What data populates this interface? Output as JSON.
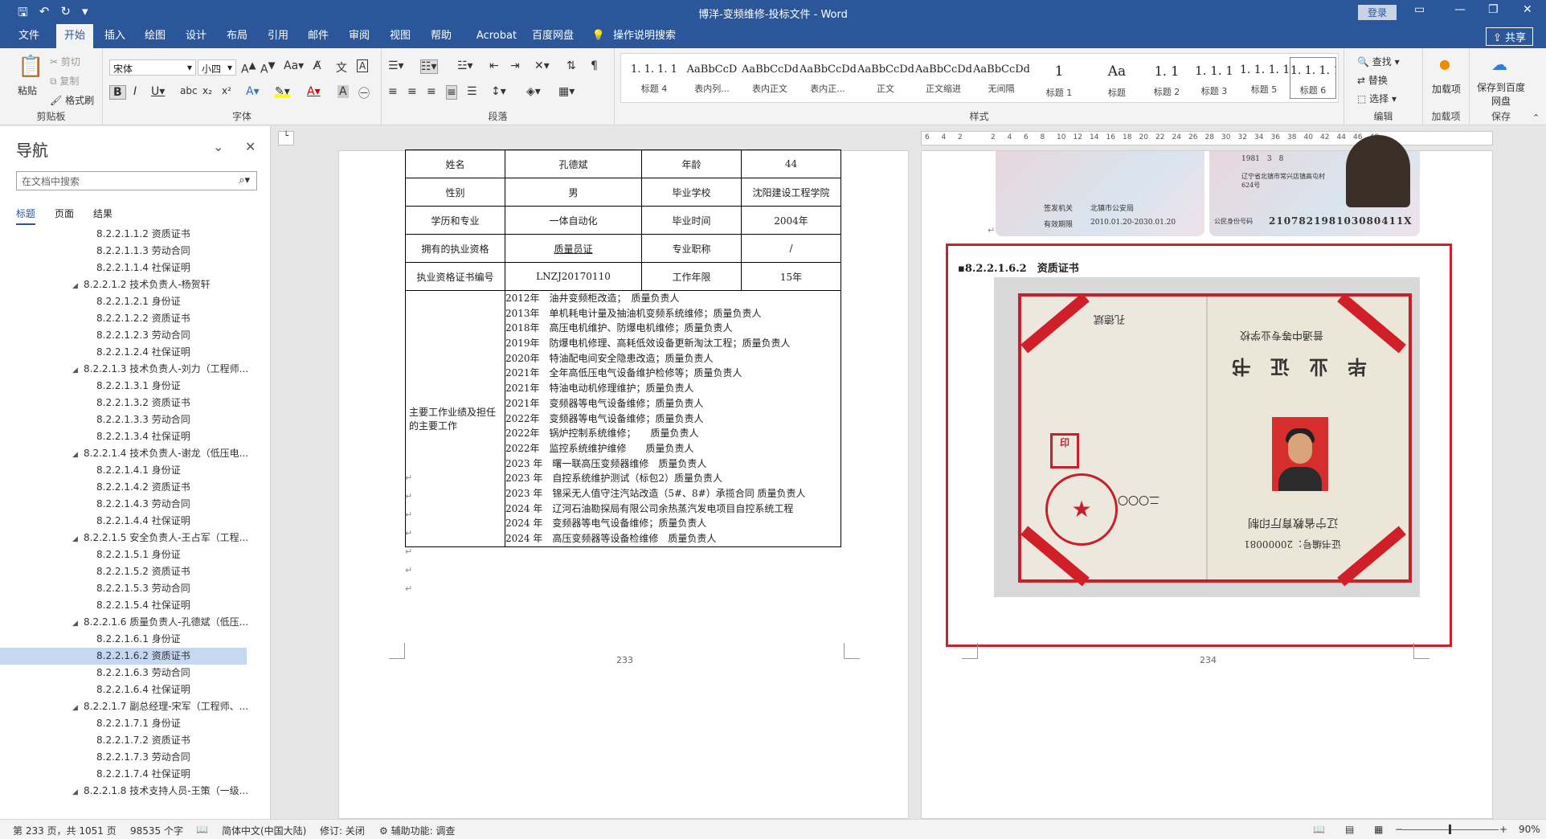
{
  "window": {
    "title": "博洋-变频维修-投标文件 - Word",
    "login": "登录"
  },
  "ribbon_tabs": [
    "文件",
    "开始",
    "插入",
    "绘图",
    "设计",
    "布局",
    "引用",
    "邮件",
    "审阅",
    "视图",
    "帮助",
    "Acrobat",
    "百度网盘",
    "操作说明搜索"
  ],
  "active_tab": "开始",
  "share_label": "共享",
  "clipboard": {
    "paste": "粘贴",
    "cut": "剪切",
    "copy": "复制",
    "format_painter": "格式刷",
    "label": "剪贴板"
  },
  "font": {
    "name": "宋体",
    "size": "小四",
    "label": "字体"
  },
  "paragraph": {
    "label": "段落"
  },
  "styles": {
    "label": "样式",
    "items": [
      {
        "sample": "1. 1. 1. 1",
        "name": "标题 4"
      },
      {
        "sample": "AaBbCcD",
        "name": "表内列..."
      },
      {
        "sample": "AaBbCcDdI",
        "name": "表内正文"
      },
      {
        "sample": "AaBbCcDdI",
        "name": "表内正..."
      },
      {
        "sample": "AaBbCcDdI",
        "name": "正文"
      },
      {
        "sample": "AaBbCcDdI",
        "name": "正文缩进"
      },
      {
        "sample": "AaBbCcDdI",
        "name": "无间隔"
      },
      {
        "sample": "1",
        "name": "标题 1"
      },
      {
        "sample": "Aa",
        "name": "标题"
      },
      {
        "sample": "1. 1",
        "name": "标题 2"
      },
      {
        "sample": "1. 1. 1",
        "name": "标题 3"
      },
      {
        "sample": "1. 1. 1. 1.",
        "name": "标题 5"
      },
      {
        "sample": "1. 1. 1. 1",
        "name": "标题 6"
      }
    ]
  },
  "editing": {
    "find": "查找",
    "replace": "替换",
    "select": "选择",
    "label": "编辑"
  },
  "addin": {
    "load": "加载项",
    "label": "加载项"
  },
  "save_group": {
    "save": "保存到百度网盘",
    "label": "保存"
  },
  "navigation": {
    "title": "导航",
    "search_placeholder": "在文档中搜索",
    "tabs": [
      "标题",
      "页面",
      "结果"
    ],
    "items": [
      {
        "level": 2,
        "text": "8.2.2.1.1.2 资质证书"
      },
      {
        "level": 2,
        "text": "8.2.2.1.1.3 劳动合同"
      },
      {
        "level": 2,
        "text": "8.2.2.1.1.4 社保证明"
      },
      {
        "level": 1,
        "text": "8.2.2.1.2 技术负责人-杨贺轩"
      },
      {
        "level": 2,
        "text": "8.2.2.1.2.1 身份证"
      },
      {
        "level": 2,
        "text": "8.2.2.1.2.2 资质证书"
      },
      {
        "level": 2,
        "text": "8.2.2.1.2.3 劳动合同"
      },
      {
        "level": 2,
        "text": "8.2.2.1.2.4 社保证明"
      },
      {
        "level": 1,
        "text": "8.2.2.1.3 技术负责人-刘力（工程师..."
      },
      {
        "level": 2,
        "text": "8.2.2.1.3.1 身份证"
      },
      {
        "level": 2,
        "text": "8.2.2.1.3.2 资质证书"
      },
      {
        "level": 2,
        "text": "8.2.2.1.3.3 劳动合同"
      },
      {
        "level": 2,
        "text": "8.2.2.1.3.4 社保证明"
      },
      {
        "level": 1,
        "text": "8.2.2.1.4 技术负责人-谢龙（低压电..."
      },
      {
        "level": 2,
        "text": "8.2.2.1.4.1 身份证"
      },
      {
        "level": 2,
        "text": "8.2.2.1.4.2 资质证书"
      },
      {
        "level": 2,
        "text": "8.2.2.1.4.3 劳动合同"
      },
      {
        "level": 2,
        "text": "8.2.2.1.4.4 社保证明"
      },
      {
        "level": 1,
        "text": "8.2.2.1.5 安全负责人-王占军（工程..."
      },
      {
        "level": 2,
        "text": "8.2.2.1.5.1 身份证"
      },
      {
        "level": 2,
        "text": "8.2.2.1.5.2 资质证书"
      },
      {
        "level": 2,
        "text": "8.2.2.1.5.3 劳动合同"
      },
      {
        "level": 2,
        "text": "8.2.2.1.5.4 社保证明"
      },
      {
        "level": 1,
        "text": "8.2.2.1.6 质量负责人-孔德斌（低压..."
      },
      {
        "level": 2,
        "text": "8.2.2.1.6.1 身份证"
      },
      {
        "level": 2,
        "text": "8.2.2.1.6.2 资质证书",
        "selected": true
      },
      {
        "level": 2,
        "text": "8.2.2.1.6.3 劳动合同"
      },
      {
        "level": 2,
        "text": "8.2.2.1.6.4 社保证明"
      },
      {
        "level": 1,
        "text": "8.2.2.1.7 副总经理-宋军（工程师、..."
      },
      {
        "level": 2,
        "text": "8.2.2.1.7.1 身份证"
      },
      {
        "level": 2,
        "text": "8.2.2.1.7.2 资质证书"
      },
      {
        "level": 2,
        "text": "8.2.2.1.7.3 劳动合同"
      },
      {
        "level": 2,
        "text": "8.2.2.1.7.4 社保证明"
      },
      {
        "level": 1,
        "text": "8.2.2.1.8 技术支持人员-王策（一级..."
      }
    ]
  },
  "page1": {
    "table": {
      "row1": [
        "姓名",
        "孔德斌",
        "年龄",
        "44"
      ],
      "row2": [
        "性别",
        "男",
        "毕业学校",
        "沈阳建设工程学院"
      ],
      "row3": [
        "学历和专业",
        "一体自动化",
        "毕业时间",
        "2004年"
      ],
      "row4": [
        "拥有的执业资格",
        "质量员证",
        "专业职称",
        "/"
      ],
      "row5": [
        "执业资格证书编号",
        "LNZJ20170110",
        "工作年限",
        "15年"
      ],
      "work_label": "主要工作业绩及担任的主要工作",
      "work_lines": [
        "2012年　油井变频柜改造；　质量负责人",
        "2013年　单机耗电计量及抽油机变频系统维修；质量负责人",
        "2018年　高压电机维护、防爆电机维修；质量负责人",
        "2019年　防爆电机修理、高耗低效设备更新淘汰工程；质量负责人",
        "2020年　特油配电间安全隐患改造；质量负责人",
        "2021年　全年高低压电气设备维护检修等；质量负责人",
        "2021年　特油电动机修理维护；质量负责人",
        "2021年　变频器等电气设备维修；质量负责人",
        "2022年　变频器等电气设备维修；质量负责人",
        "2022年　锅炉控制系统维修；　　质量负责人",
        "2022年　监控系统维护维修　　质量负责人",
        "2023 年　曙一联高压变频器维修　质量负责人",
        "2023 年　自控系统维护测试（标包2）质量负责人",
        "2023 年　锦采无人值守注汽站改造（5#、8#）承揽合同 质量负责人",
        "2024 年　辽河石油勘探局有限公司余热蒸汽发电项目自控系统工程",
        "2024 年　变频器等电气设备维修；质量负责人",
        "2024 年　高压变频器等设备检维修　质量负责人"
      ]
    },
    "page_number": "233"
  },
  "page2": {
    "idcard": {
      "issuer_label": "签发机关",
      "issuer": "北镇市公安局",
      "valid_label": "有效期限",
      "valid": "2010.01.20-2030.01.20",
      "birth": "1981　3　8",
      "address": "辽宁省北镇市常兴店镇高屯村624号",
      "id_label": "公民身份号码",
      "id_number": "210782198103080411X"
    },
    "heading": "8.2.2.1.6.2　资质证书",
    "certificate": {
      "title": "毕　业　证　书",
      "school_header": "普通中等专业学校",
      "issuer": "辽宁省教育厅印制",
      "cert_no": "证书编号：20000081",
      "date_seal": "二〇〇〇",
      "name": "孔德斌"
    },
    "page_number": "234"
  },
  "status": {
    "page": "第 233 页，共 1051 页",
    "words": "98535 个字",
    "language": "简体中文(中国大陆)",
    "track": "修订: 关闭",
    "accessibility": "辅助功能: 调查",
    "zoom": "90%"
  }
}
